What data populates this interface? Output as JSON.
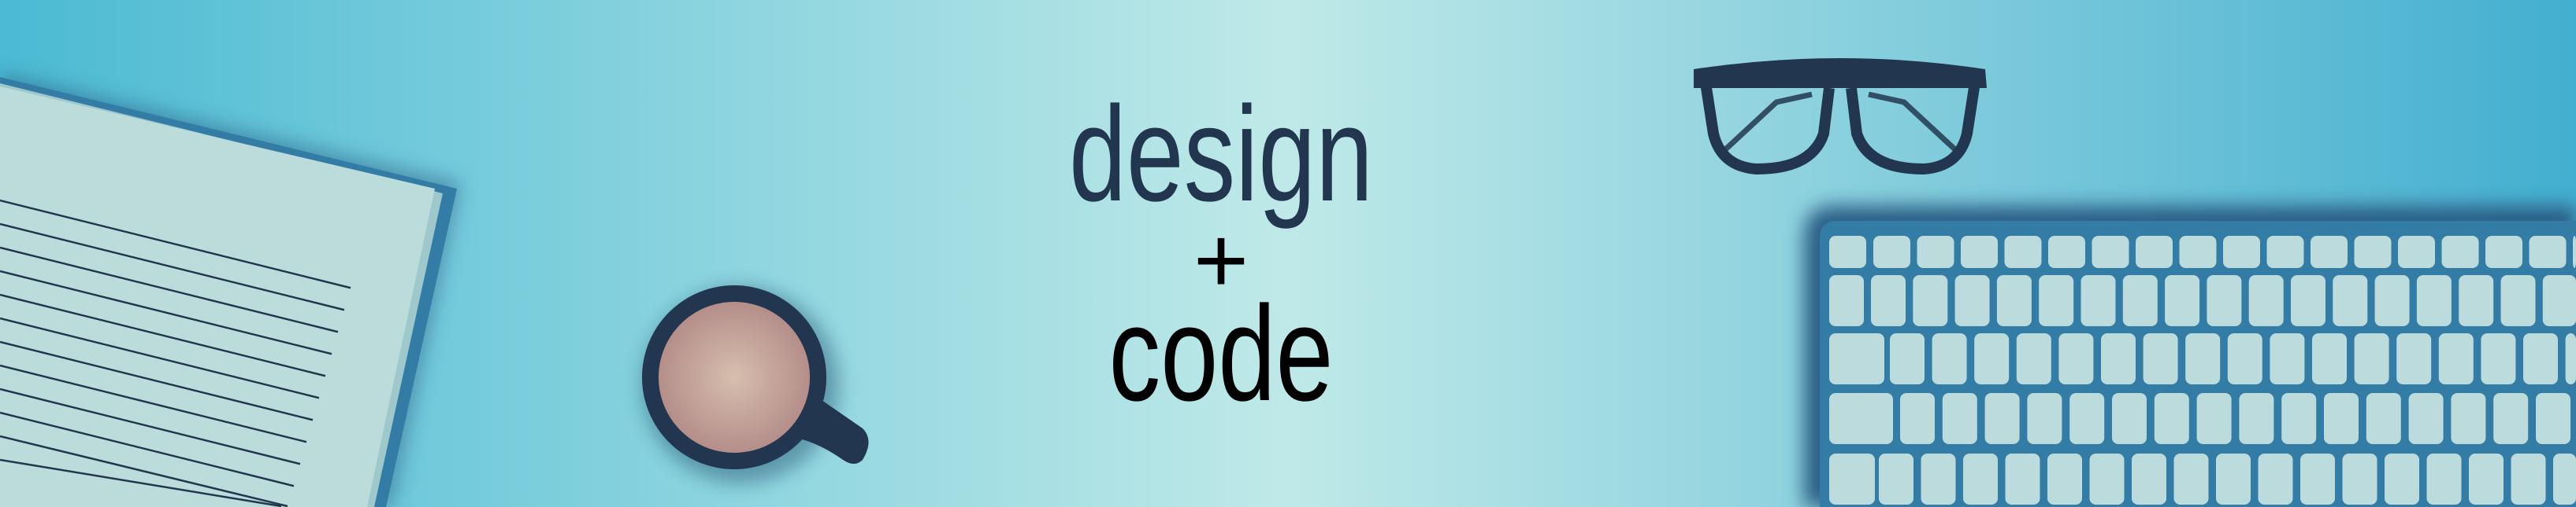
{
  "banner": {
    "line1": "design",
    "line2": "+",
    "line3": "code"
  },
  "colors": {
    "bg_edge": "#46b4d2",
    "bg_center": "#bfe9e8",
    "navy": "#22374f",
    "keyboard": "#327ca5",
    "key": "#bbdbdc",
    "paper": "#bcdcdc",
    "coffee": "#d2b6a8"
  }
}
